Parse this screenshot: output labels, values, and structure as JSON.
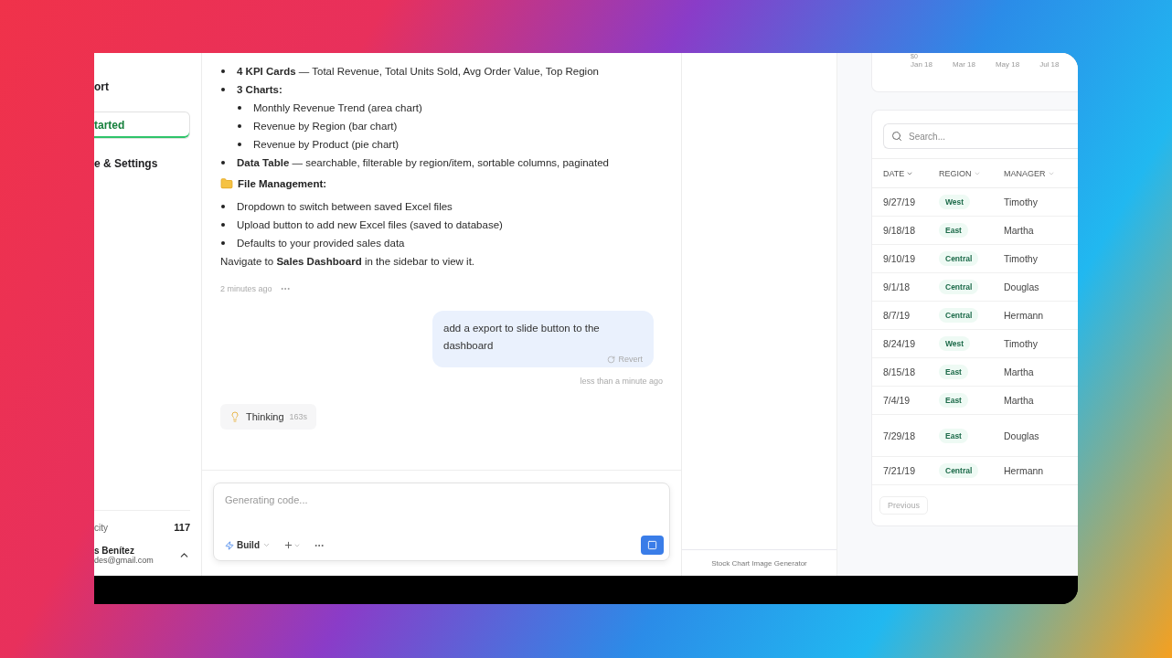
{
  "sidebar": {
    "items": [
      {
        "label": "ort",
        "selected": false
      },
      {
        "label": "tarted",
        "selected": true
      },
      {
        "label": "e & Settings",
        "selected": false
      }
    ],
    "credits": {
      "label": "city",
      "value": "117"
    },
    "user": {
      "name": "s Benítez",
      "email": "des@gmail.com"
    }
  },
  "chat": {
    "assistant_message": {
      "blocks": [
        {
          "kind": "bullet",
          "text": "**4 KPI Cards** — Total Revenue, Total Units Sold, Avg Order Value, Top Region",
          "strong": false
        },
        {
          "kind": "bullet",
          "text": "3 Charts:",
          "strong": true,
          "children": [
            {
              "text": "Monthly Revenue Trend (area chart)"
            },
            {
              "text": "Revenue by Region (bar chart)"
            },
            {
              "text": "Revenue by Product (pie chart)"
            }
          ]
        },
        {
          "kind": "bullet",
          "text": "**Data Table** — searchable, filterable by region/item, sortable columns, paginated",
          "strong": false
        },
        {
          "kind": "heading",
          "text": "File Management:"
        },
        {
          "kind": "bullet",
          "text": "Dropdown to switch between saved Excel files",
          "strong": false
        },
        {
          "kind": "bullet",
          "text": "Upload button to add new Excel files (saved to database)",
          "strong": false
        },
        {
          "kind": "bullet",
          "text": "Defaults to your provided sales data",
          "strong": false
        },
        {
          "kind": "paragraph",
          "text": "Navigate to **Sales Dashboard** in the sidebar to view it."
        }
      ],
      "time": "2 minutes ago"
    },
    "user_message": {
      "text": "add a export to slide button to the dashboard",
      "revert": "Revert",
      "time": "less than a minute ago"
    },
    "thinking": {
      "label": "Thinking",
      "duration": "163s"
    },
    "composer": {
      "placeholder": "Generating code...",
      "mode": "Build"
    }
  },
  "preview": {
    "footer": "Stock Chart Image Generator"
  },
  "dashboard": {
    "chart": {
      "y_tick": "$0",
      "x_ticks": [
        "Jan 18",
        "Mar 18",
        "May 18",
        "Jul 18"
      ]
    },
    "search": {
      "placeholder": "Search..."
    },
    "columns": [
      "DATE",
      "REGION",
      "MANAGER"
    ],
    "rows": [
      {
        "date": "9/27/19",
        "region": "West",
        "manager": "Timothy"
      },
      {
        "date": "9/18/18",
        "region": "East",
        "manager": "Martha"
      },
      {
        "date": "9/10/19",
        "region": "Central",
        "manager": "Timothy"
      },
      {
        "date": "9/1/18",
        "region": "Central",
        "manager": "Douglas"
      },
      {
        "date": "8/7/19",
        "region": "Central",
        "manager": "Hermann"
      },
      {
        "date": "8/24/19",
        "region": "West",
        "manager": "Timothy"
      },
      {
        "date": "8/15/18",
        "region": "East",
        "manager": "Martha"
      },
      {
        "date": "7/4/19",
        "region": "East",
        "manager": "Martha"
      },
      {
        "date": "7/29/18",
        "region": "East",
        "manager": "Douglas"
      },
      {
        "date": "7/21/19",
        "region": "Central",
        "manager": "Hermann"
      }
    ],
    "pagination": {
      "previous": "Previous"
    }
  }
}
